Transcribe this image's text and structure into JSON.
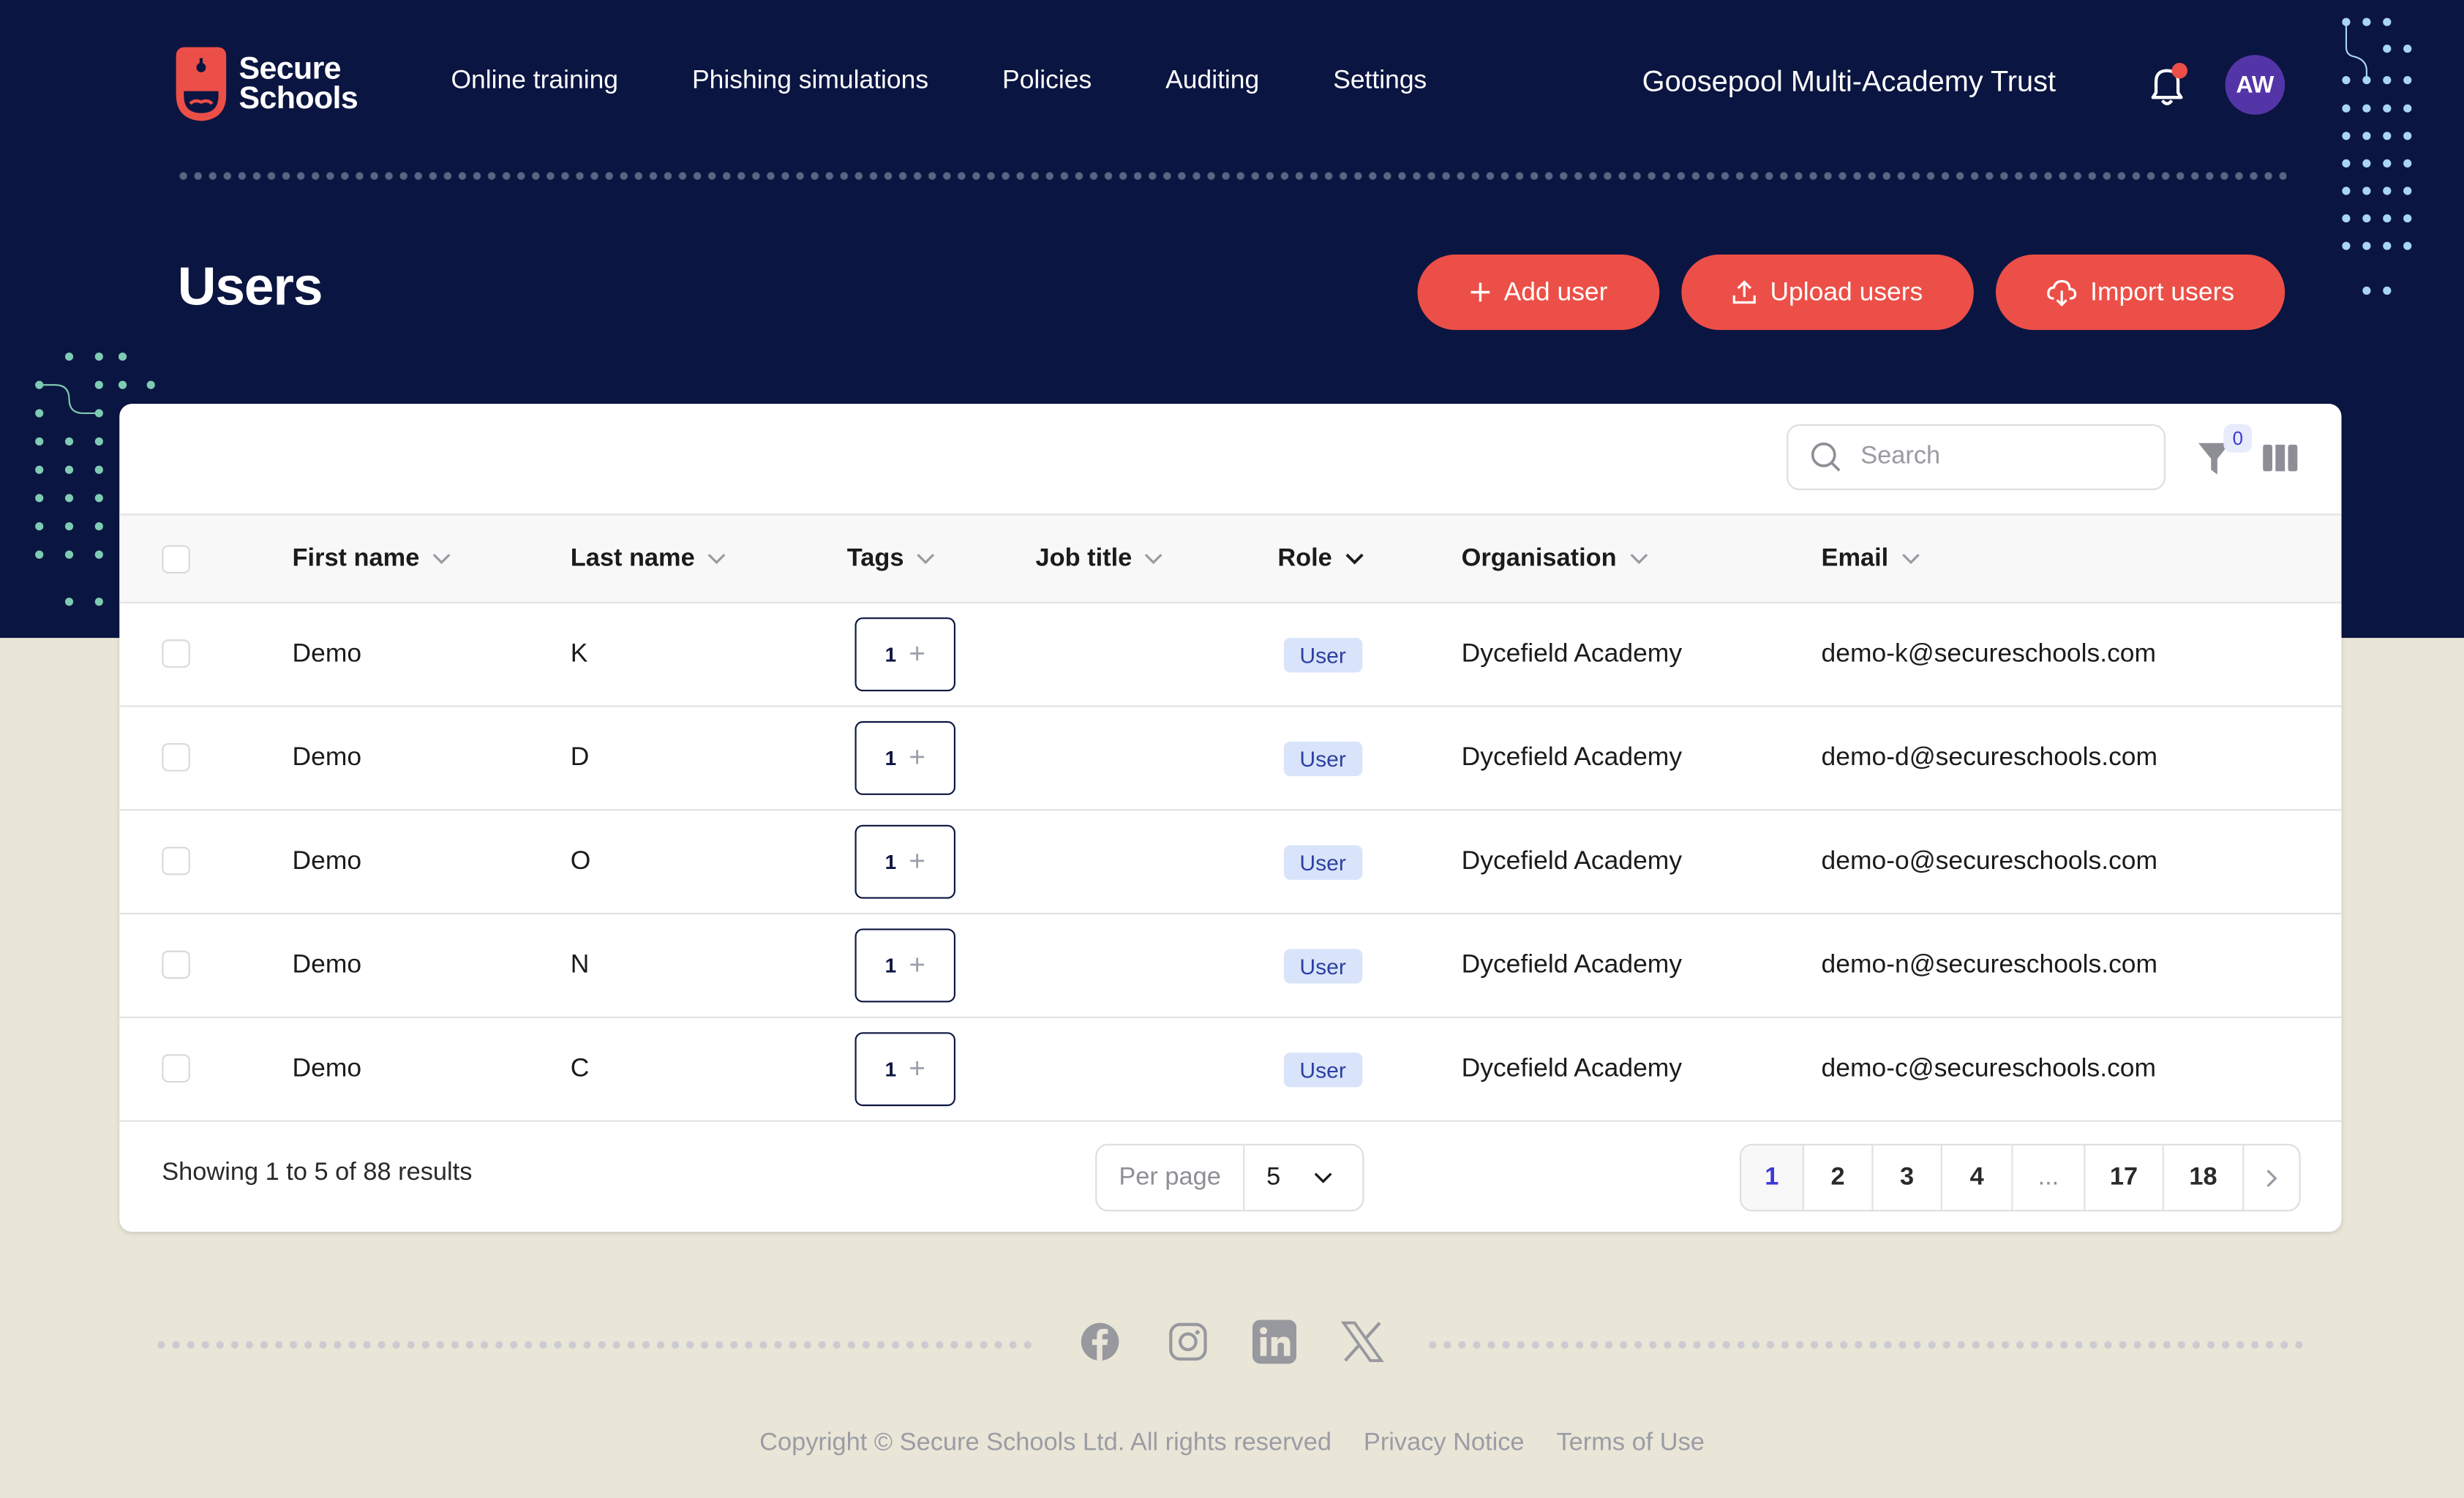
{
  "brand": {
    "name_line1": "Secure",
    "name_line2": "Schools",
    "accent_color": "#ec4f47",
    "navy": "#0b1541"
  },
  "nav": {
    "items": [
      {
        "label": "Online training"
      },
      {
        "label": "Phishing simulations"
      },
      {
        "label": "Policies"
      },
      {
        "label": "Auditing"
      },
      {
        "label": "Settings"
      }
    ]
  },
  "header": {
    "organisation": "Goosepool Multi-Academy Trust",
    "avatar_initials": "AW",
    "notification_dot": true
  },
  "page": {
    "title": "Users"
  },
  "actions": {
    "add_user": "Add user",
    "upload_users": "Upload users",
    "import_users": "Import users"
  },
  "toolbar": {
    "search_placeholder": "Search",
    "search_value": "",
    "filter_count": "0"
  },
  "table": {
    "columns": [
      {
        "label": "First name",
        "sorted": false
      },
      {
        "label": "Last name",
        "sorted": false
      },
      {
        "label": "Tags",
        "sorted": false
      },
      {
        "label": "Job title",
        "sorted": false
      },
      {
        "label": "Role",
        "sorted": true
      },
      {
        "label": "Organisation",
        "sorted": false
      },
      {
        "label": "Email",
        "sorted": false
      }
    ],
    "rows": [
      {
        "first_name": "Demo",
        "last_name": "K",
        "tags": "1",
        "job_title": "",
        "role": "User",
        "organisation": "Dycefield Academy",
        "email": "demo-k@secureschools.com"
      },
      {
        "first_name": "Demo",
        "last_name": "D",
        "tags": "1",
        "job_title": "",
        "role": "User",
        "organisation": "Dycefield Academy",
        "email": "demo-d@secureschools.com"
      },
      {
        "first_name": "Demo",
        "last_name": "O",
        "tags": "1",
        "job_title": "",
        "role": "User",
        "organisation": "Dycefield Academy",
        "email": "demo-o@secureschools.com"
      },
      {
        "first_name": "Demo",
        "last_name": "N",
        "tags": "1",
        "job_title": "",
        "role": "User",
        "organisation": "Dycefield Academy",
        "email": "demo-n@secureschools.com"
      },
      {
        "first_name": "Demo",
        "last_name": "C",
        "tags": "1",
        "job_title": "",
        "role": "User",
        "organisation": "Dycefield Academy",
        "email": "demo-c@secureschools.com"
      }
    ]
  },
  "pagination": {
    "summary": "Showing 1 to 5 of 88 results",
    "per_page_label": "Per page",
    "per_page_value": "5",
    "pages": [
      "1",
      "2",
      "3",
      "4",
      "...",
      "17",
      "18"
    ],
    "current_page": "1"
  },
  "footer": {
    "social": [
      "facebook",
      "instagram",
      "linkedin",
      "x"
    ],
    "copyright": "Copyright © Secure Schools Ltd. All rights reserved",
    "privacy": "Privacy Notice",
    "terms": "Terms of Use"
  }
}
